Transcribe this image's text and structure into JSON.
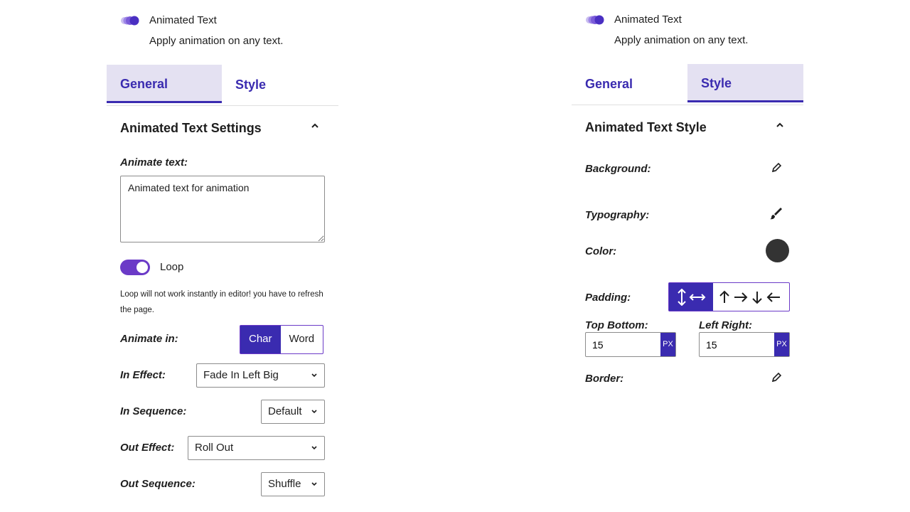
{
  "block": {
    "title": "Animated Text",
    "description": "Apply animation on any text."
  },
  "tabs": {
    "general": "General",
    "style": "Style"
  },
  "general_panel": {
    "section_title": "Animated Text Settings",
    "animate_text_label": "Animate text:",
    "animate_text_value": "Animated text for animation",
    "loop_label": "Loop",
    "loop_enabled": true,
    "loop_note": "Loop will not work instantly in editor! you have to refresh the page.",
    "animate_in_label": "Animate in:",
    "animate_in_options": [
      "Char",
      "Word"
    ],
    "animate_in_selected": "Char",
    "in_effect_label": "In Effect:",
    "in_effect_value": "Fade In Left Big",
    "in_sequence_label": "In Sequence:",
    "in_sequence_value": "Default",
    "out_effect_label": "Out Effect:",
    "out_effect_value": "Roll Out",
    "out_sequence_label": "Out Sequence:",
    "out_sequence_value": "Shuffle"
  },
  "style_panel": {
    "section_title": "Animated Text Style",
    "background_label": "Background:",
    "typography_label": "Typography:",
    "color_label": "Color:",
    "color_value": "#333333",
    "padding_label": "Padding:",
    "top_bottom_label": "Top Bottom:",
    "top_bottom_value": "15",
    "left_right_label": "Left Right:",
    "left_right_value": "15",
    "unit": "PX",
    "border_label": "Border:"
  },
  "colors": {
    "accent": "#3a2bb0",
    "toggle": "#6b3ac7",
    "active_tab_bg": "#e4e1f2"
  },
  "icons": {
    "block_icon": "animated-text-icon",
    "caret": "chevron-up-icon",
    "edit": "pencil-icon",
    "typography": "brush-icon",
    "padding_linked": "vertical-horizontal-arrows-icon",
    "padding_sides": "up-right-down-left-arrows-icon"
  }
}
